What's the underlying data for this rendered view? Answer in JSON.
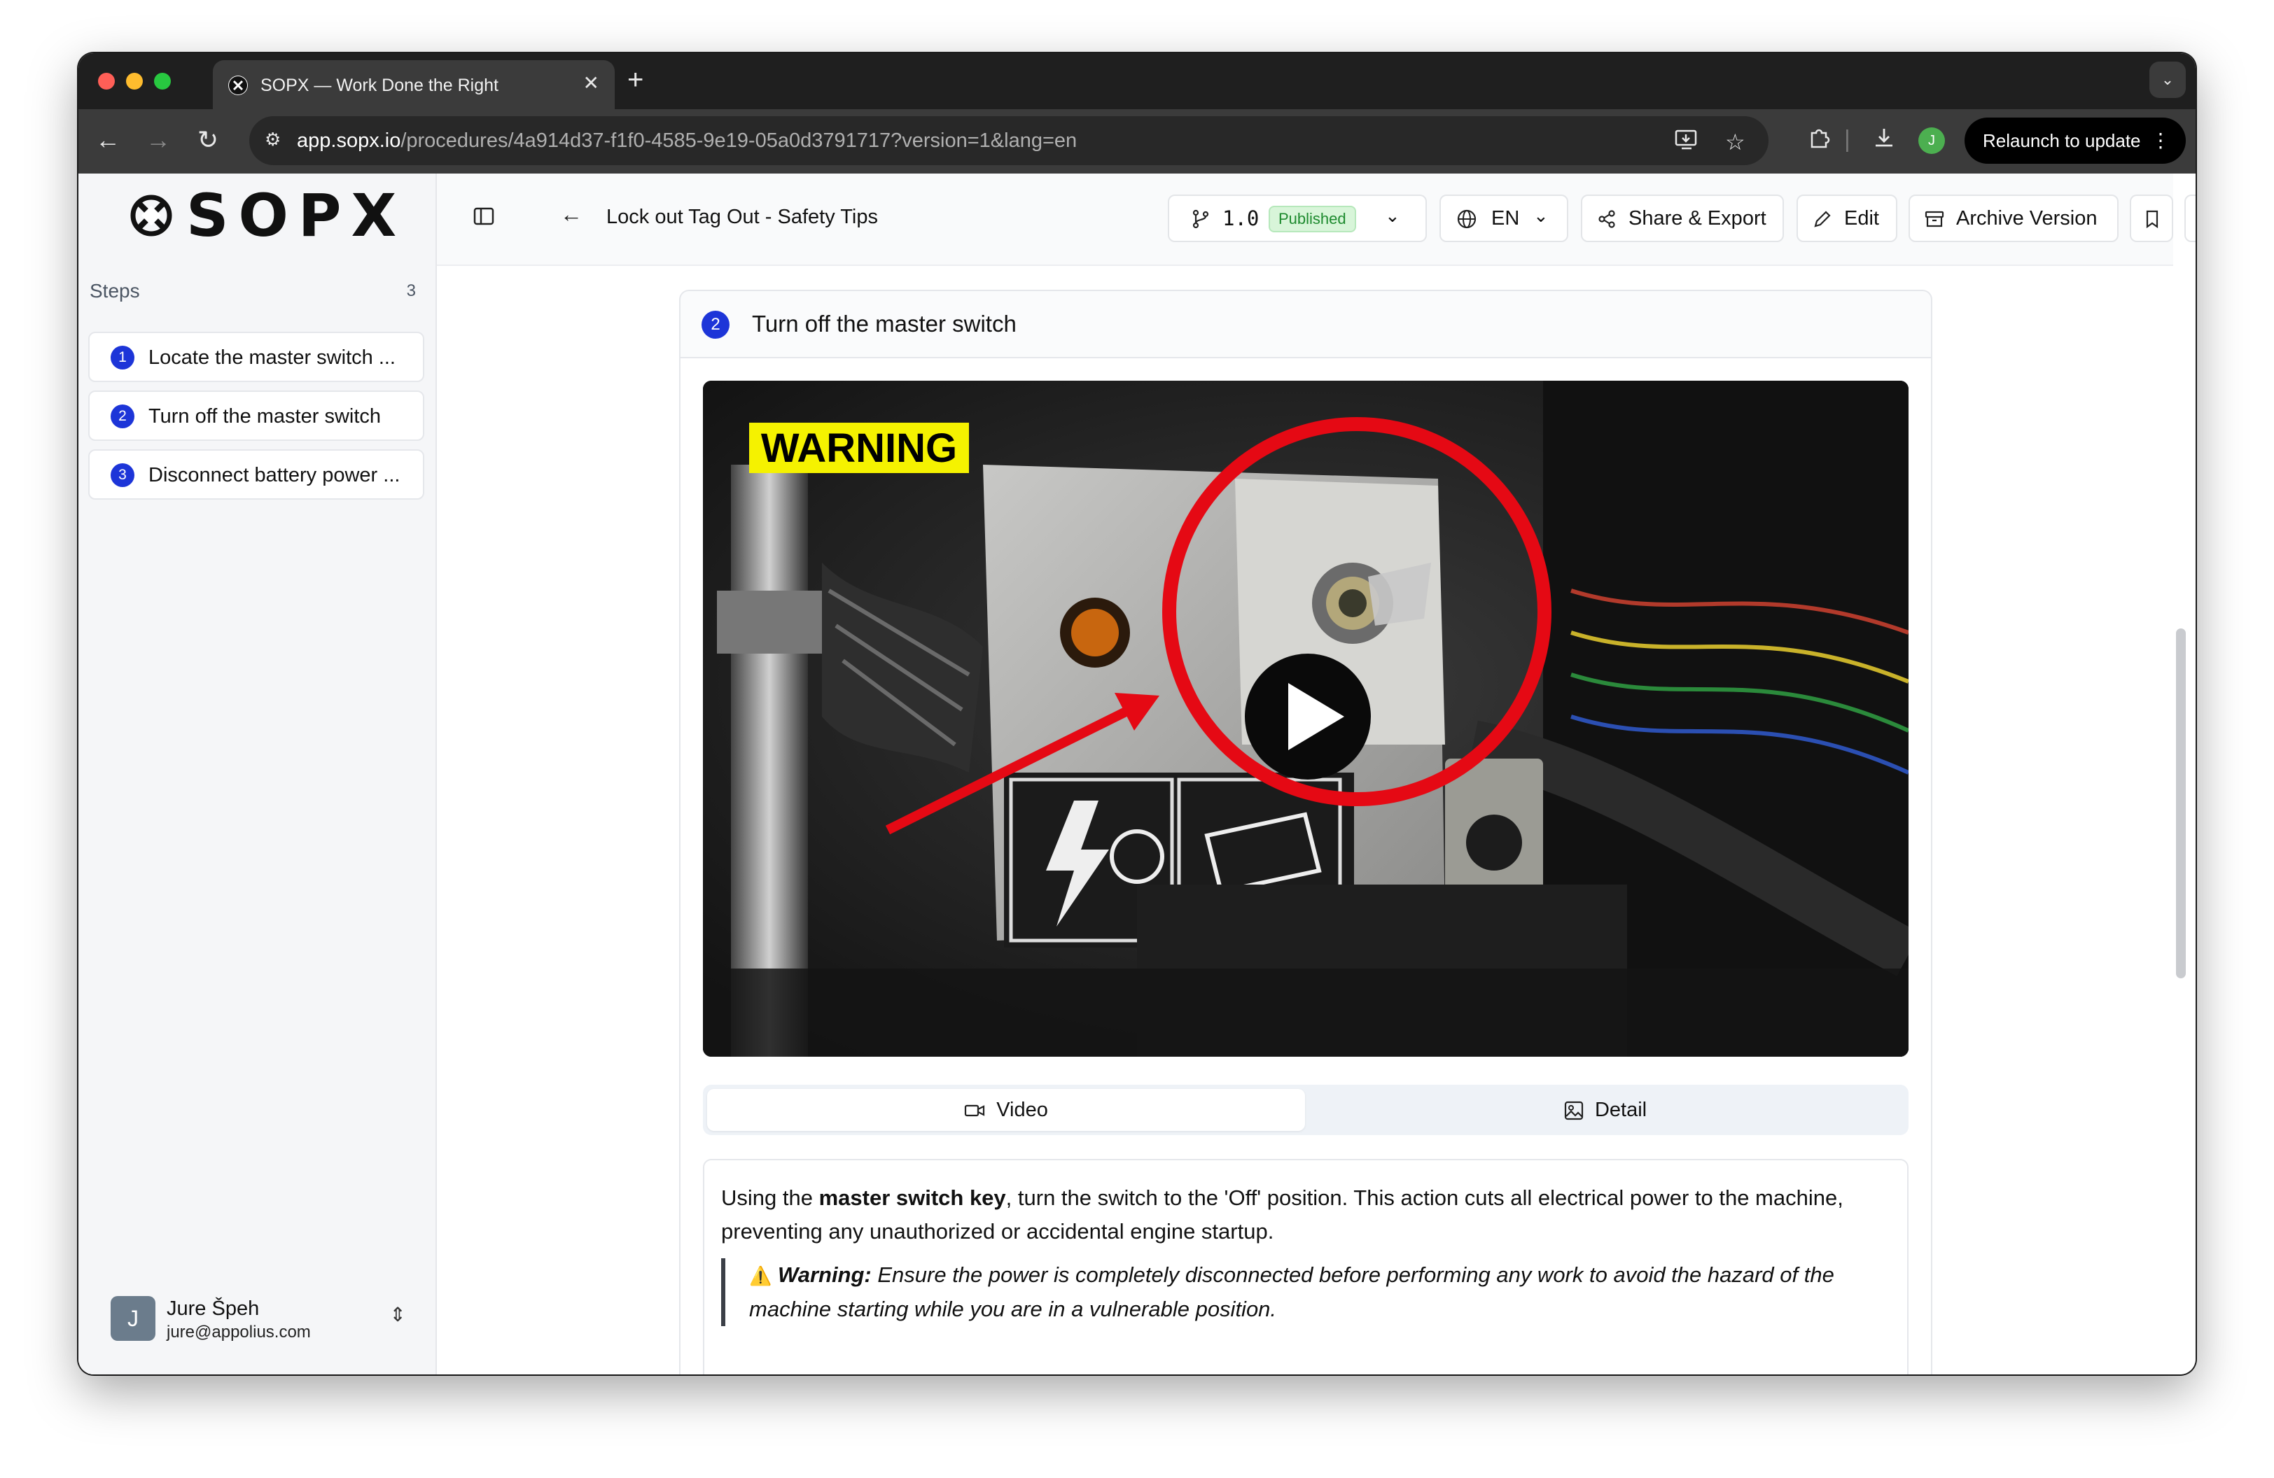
{
  "browser": {
    "tab_title": "SOPX — Work Done the Right",
    "url_host": "app.sopx.io",
    "url_path": "/procedures/4a914d37-f1f0-4585-9e19-05a0d3791717?version=1&lang=en",
    "relaunch_label": "Relaunch to update",
    "profile_initial": "J"
  },
  "sidebar": {
    "logo_text": "SOPX",
    "steps_label": "Steps",
    "steps_count": "3",
    "items": [
      {
        "num": "1",
        "label": "Locate the master switch ..."
      },
      {
        "num": "2",
        "label": "Turn off the master switch"
      },
      {
        "num": "3",
        "label": "Disconnect battery power ..."
      }
    ],
    "user": {
      "initial": "J",
      "name": "Jure Špeh",
      "email": "jure@appolius.com"
    }
  },
  "header": {
    "title": "Lock out Tag Out - Safety Tips",
    "version": "1.0",
    "status": "Published",
    "language": "EN",
    "share_label": "Share & Export",
    "edit_label": "Edit",
    "archive_label": "Archive Version"
  },
  "step": {
    "num": "2",
    "title": "Turn off the master switch",
    "video_warning_label": "WARNING",
    "tabs": {
      "video": "Video",
      "detail": "Detail"
    },
    "desc_intro": "Using the ",
    "desc_bold": "master switch key",
    "desc_rest": ", turn the switch to the 'Off' position. This action cuts all electrical power to the machine, preventing any unauthorized or accidental engine startup.",
    "warning_emoji": "⚠️",
    "warning_label": "Warning:",
    "warning_text": " Ensure the power is completely disconnected before performing any work to avoid the hazard of the machine starting while you are in a vulnerable position."
  },
  "colors": {
    "accent": "#1d35d8",
    "published_bg": "#d8f5d9",
    "published_fg": "#1d8a2e",
    "annotation_red": "#e50914",
    "warning_yellow": "#f5f200"
  }
}
